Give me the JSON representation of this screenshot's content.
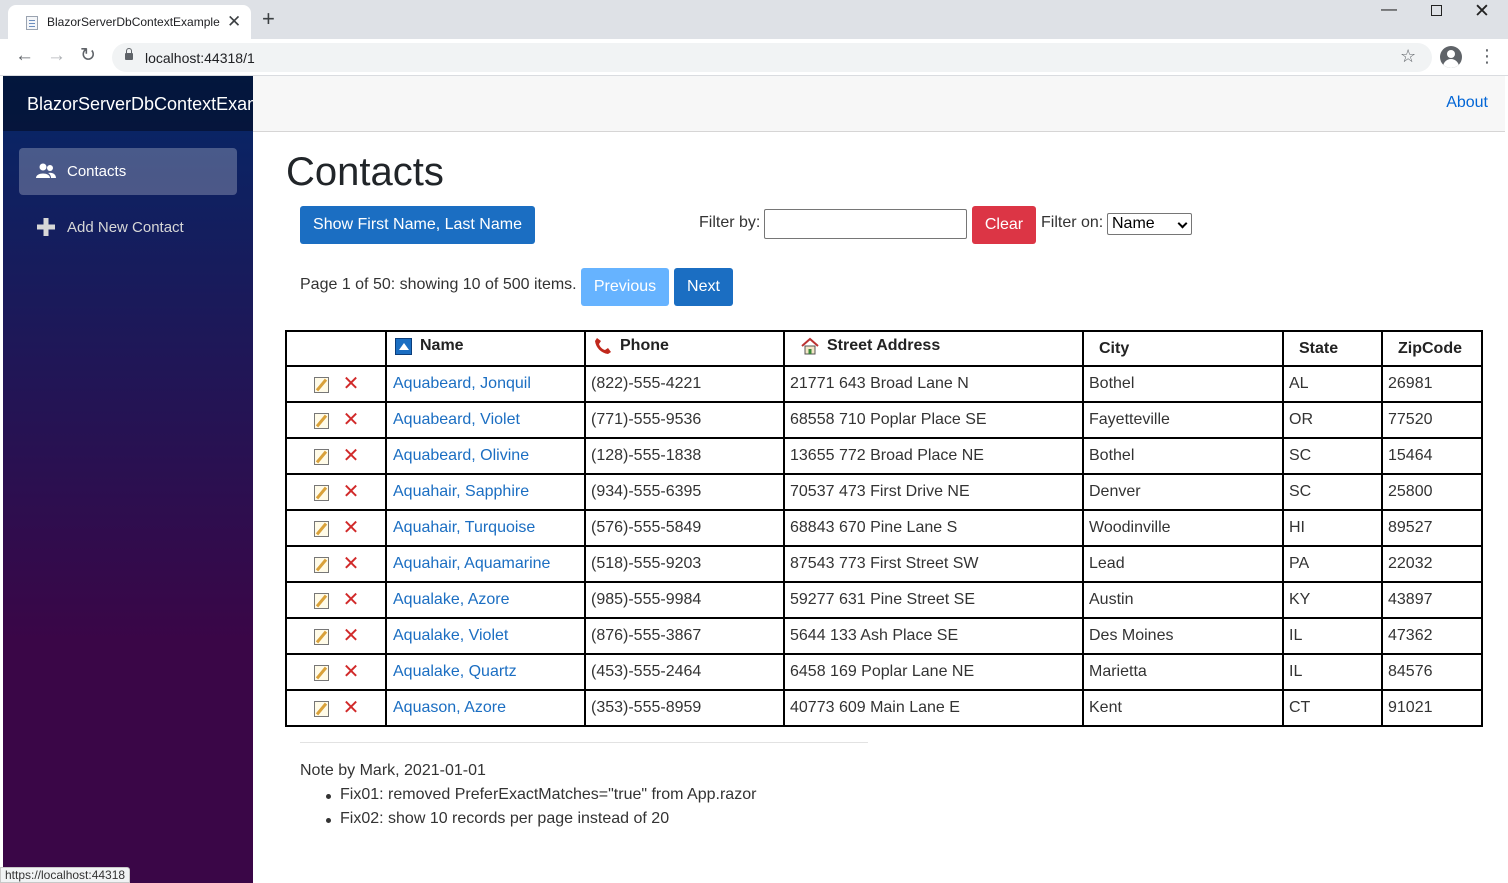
{
  "browser": {
    "tab_title": "BlazorServerDbContextExample",
    "url": "localhost:44318/1",
    "status_url": "https://localhost:44318"
  },
  "sidebar": {
    "brand": "BlazorServerDbContextExample",
    "items": [
      {
        "label": "Contacts",
        "icon": "people-icon",
        "active": true
      },
      {
        "label": "Add New Contact",
        "icon": "plus-icon",
        "active": false
      }
    ]
  },
  "header": {
    "about": "About"
  },
  "main": {
    "title": "Contacts",
    "show_button": "Show First Name, Last Name",
    "filter_by_label": "Filter by:",
    "filter_value": "",
    "clear_button": "Clear",
    "filter_on_label": "Filter on:",
    "filter_on_selected": "Name",
    "page_info": "Page 1 of 50: showing 10 of 500 items.",
    "prev_button": "Previous",
    "next_button": "Next"
  },
  "table": {
    "columns": [
      "",
      "Name",
      "Phone",
      "Street Address",
      "City",
      "State",
      "ZipCode"
    ],
    "rows": [
      {
        "name": "Aquabeard, Jonquil",
        "phone": "(822)-555-4221",
        "street": "21771 643 Broad Lane N",
        "city": "Bothel",
        "state": "AL",
        "zip": "26981"
      },
      {
        "name": "Aquabeard, Violet",
        "phone": "(771)-555-9536",
        "street": "68558 710 Poplar Place SE",
        "city": "Fayetteville",
        "state": "OR",
        "zip": "77520"
      },
      {
        "name": "Aquabeard, Olivine",
        "phone": "(128)-555-1838",
        "street": "13655 772 Broad Place NE",
        "city": "Bothel",
        "state": "SC",
        "zip": "15464"
      },
      {
        "name": "Aquahair, Sapphire",
        "phone": "(934)-555-6395",
        "street": "70537 473 First Drive NE",
        "city": "Denver",
        "state": "SC",
        "zip": "25800"
      },
      {
        "name": "Aquahair, Turquoise",
        "phone": "(576)-555-5849",
        "street": "68843 670 Pine Lane S",
        "city": "Woodinville",
        "state": "HI",
        "zip": "89527"
      },
      {
        "name": "Aquahair, Aquamarine",
        "phone": "(518)-555-9203",
        "street": "87543 773 First Street SW",
        "city": "Lead",
        "state": "PA",
        "zip": "22032"
      },
      {
        "name": "Aqualake, Azore",
        "phone": "(985)-555-9984",
        "street": "59277 631 Pine Street SE",
        "city": "Austin",
        "state": "KY",
        "zip": "43897"
      },
      {
        "name": "Aqualake, Violet",
        "phone": "(876)-555-3867",
        "street": "5644 133 Ash Place SE",
        "city": "Des Moines",
        "state": "IL",
        "zip": "47362"
      },
      {
        "name": "Aqualake, Quartz",
        "phone": "(453)-555-2464",
        "street": "6458 169 Poplar Lane NE",
        "city": "Marietta",
        "state": "IL",
        "zip": "84576"
      },
      {
        "name": "Aquason, Azore",
        "phone": "(353)-555-8959",
        "street": "40773 609 Main Lane E",
        "city": "Kent",
        "state": "CT",
        "zip": "91021"
      }
    ]
  },
  "note": {
    "title": "Note by Mark, 2021-01-01",
    "items": [
      "Fix01: removed PreferExactMatches=\"true\" from App.razor",
      "Fix02: show 10 records per page instead of 20"
    ]
  },
  "colors": {
    "primary": "#1b6ec2",
    "danger": "#dc3545",
    "disabled": "#66b3ff",
    "link": "#0366d6"
  }
}
